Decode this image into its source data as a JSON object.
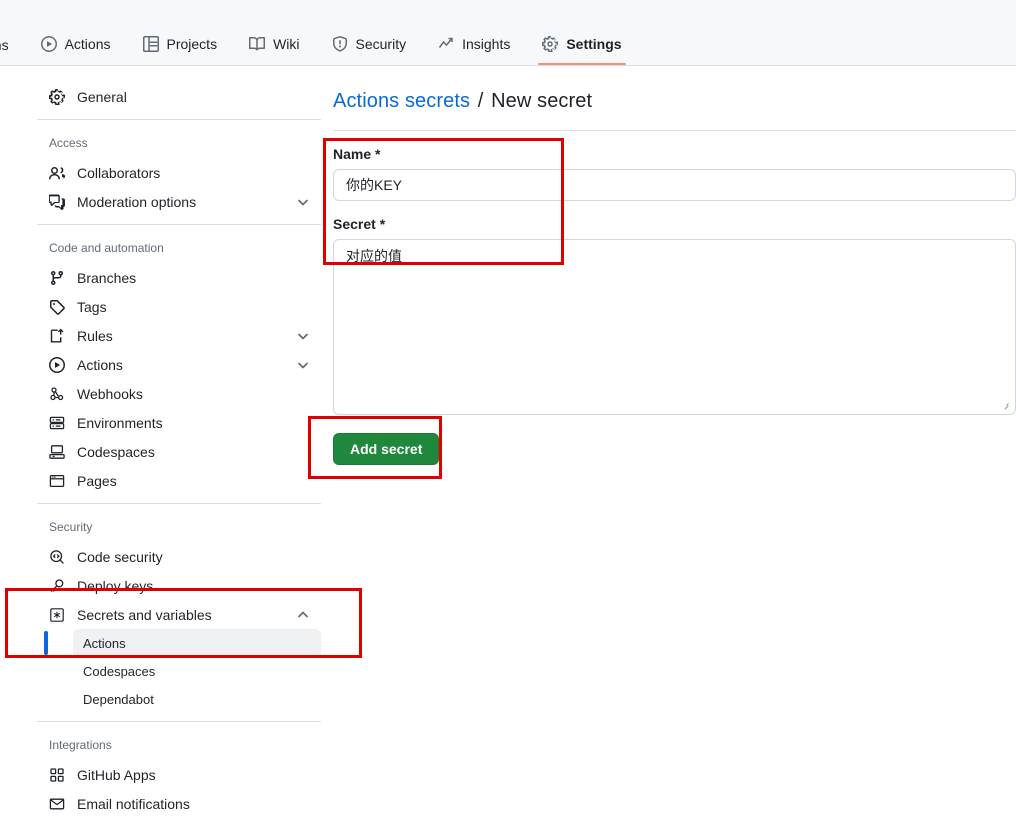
{
  "repo_nav": {
    "tabs": [
      {
        "label": "ons",
        "icon": "",
        "selected": false,
        "truncated": true
      },
      {
        "label": "Actions",
        "icon": "play-circle-icon",
        "selected": false
      },
      {
        "label": "Projects",
        "icon": "table-icon",
        "selected": false
      },
      {
        "label": "Wiki",
        "icon": "book-icon",
        "selected": false
      },
      {
        "label": "Security",
        "icon": "shield-icon",
        "selected": false
      },
      {
        "label": "Insights",
        "icon": "graph-icon",
        "selected": false
      },
      {
        "label": "Settings",
        "icon": "gear-icon",
        "selected": true
      }
    ]
  },
  "sidebar": {
    "top_items": [
      {
        "label": "General",
        "icon": "gear-icon",
        "chevron": false
      }
    ],
    "groups": [
      {
        "title": "Access",
        "items": [
          {
            "label": "Collaborators",
            "icon": "people-icon",
            "chevron": false
          },
          {
            "label": "Moderation options",
            "icon": "comment-discussion-icon",
            "chevron": true
          }
        ]
      },
      {
        "title": "Code and automation",
        "items": [
          {
            "label": "Branches",
            "icon": "git-branch-icon",
            "chevron": false
          },
          {
            "label": "Tags",
            "icon": "tag-icon",
            "chevron": false
          },
          {
            "label": "Rules",
            "icon": "rules-icon",
            "chevron": true
          },
          {
            "label": "Actions",
            "icon": "play-circle-icon",
            "chevron": true
          },
          {
            "label": "Webhooks",
            "icon": "webhook-icon",
            "chevron": false
          },
          {
            "label": "Environments",
            "icon": "server-icon",
            "chevron": false
          },
          {
            "label": "Codespaces",
            "icon": "codespaces-icon",
            "chevron": false
          },
          {
            "label": "Pages",
            "icon": "browser-icon",
            "chevron": false
          }
        ]
      },
      {
        "title": "Security",
        "items": [
          {
            "label": "Code security",
            "icon": "codescan-icon",
            "chevron": false
          },
          {
            "label": "Deploy keys",
            "icon": "key-icon",
            "chevron": false
          },
          {
            "label": "Secrets and variables",
            "icon": "asterisk-box-icon",
            "chevron": true,
            "expanded": true
          }
        ],
        "sub_items": [
          {
            "label": "Actions",
            "selected": true
          },
          {
            "label": "Codespaces",
            "selected": false
          },
          {
            "label": "Dependabot",
            "selected": false
          }
        ]
      },
      {
        "title": "Integrations",
        "items": [
          {
            "label": "GitHub Apps",
            "icon": "apps-icon",
            "chevron": false
          },
          {
            "label": "Email notifications",
            "icon": "mail-icon",
            "chevron": false
          }
        ]
      }
    ]
  },
  "main": {
    "breadcrumb": {
      "link": "Actions secrets",
      "separator": "/",
      "current": "New secret"
    },
    "form": {
      "name_label": "Name *",
      "name_value": "你的KEY",
      "secret_label": "Secret *",
      "secret_value": "对应的值"
    },
    "submit_label": "Add secret"
  },
  "colors": {
    "accent_link": "#0969da",
    "selected_tab_underline": "#fd8c73",
    "button_green": "#1f883d",
    "annotation_red": "#e00000",
    "selected_bar_blue": "#0969da"
  }
}
